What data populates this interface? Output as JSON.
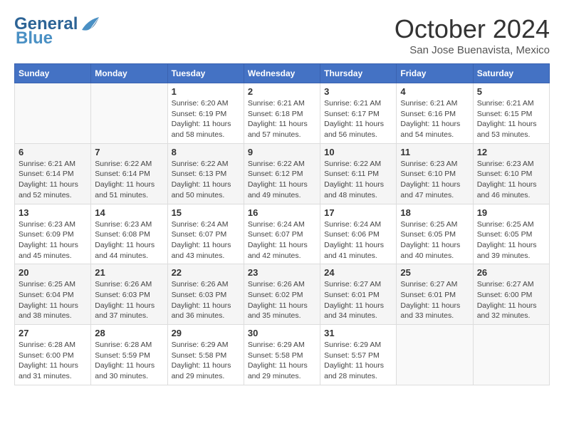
{
  "logo": {
    "line1": "General",
    "line2": "Blue"
  },
  "title": "October 2024",
  "subtitle": "San Jose Buenavista, Mexico",
  "days_of_week": [
    "Sunday",
    "Monday",
    "Tuesday",
    "Wednesday",
    "Thursday",
    "Friday",
    "Saturday"
  ],
  "weeks": [
    [
      {
        "day": "",
        "info": ""
      },
      {
        "day": "",
        "info": ""
      },
      {
        "day": "1",
        "info": "Sunrise: 6:20 AM\nSunset: 6:19 PM\nDaylight: 11 hours and 58 minutes."
      },
      {
        "day": "2",
        "info": "Sunrise: 6:21 AM\nSunset: 6:18 PM\nDaylight: 11 hours and 57 minutes."
      },
      {
        "day": "3",
        "info": "Sunrise: 6:21 AM\nSunset: 6:17 PM\nDaylight: 11 hours and 56 minutes."
      },
      {
        "day": "4",
        "info": "Sunrise: 6:21 AM\nSunset: 6:16 PM\nDaylight: 11 hours and 54 minutes."
      },
      {
        "day": "5",
        "info": "Sunrise: 6:21 AM\nSunset: 6:15 PM\nDaylight: 11 hours and 53 minutes."
      }
    ],
    [
      {
        "day": "6",
        "info": "Sunrise: 6:21 AM\nSunset: 6:14 PM\nDaylight: 11 hours and 52 minutes."
      },
      {
        "day": "7",
        "info": "Sunrise: 6:22 AM\nSunset: 6:14 PM\nDaylight: 11 hours and 51 minutes."
      },
      {
        "day": "8",
        "info": "Sunrise: 6:22 AM\nSunset: 6:13 PM\nDaylight: 11 hours and 50 minutes."
      },
      {
        "day": "9",
        "info": "Sunrise: 6:22 AM\nSunset: 6:12 PM\nDaylight: 11 hours and 49 minutes."
      },
      {
        "day": "10",
        "info": "Sunrise: 6:22 AM\nSunset: 6:11 PM\nDaylight: 11 hours and 48 minutes."
      },
      {
        "day": "11",
        "info": "Sunrise: 6:23 AM\nSunset: 6:10 PM\nDaylight: 11 hours and 47 minutes."
      },
      {
        "day": "12",
        "info": "Sunrise: 6:23 AM\nSunset: 6:10 PM\nDaylight: 11 hours and 46 minutes."
      }
    ],
    [
      {
        "day": "13",
        "info": "Sunrise: 6:23 AM\nSunset: 6:09 PM\nDaylight: 11 hours and 45 minutes."
      },
      {
        "day": "14",
        "info": "Sunrise: 6:23 AM\nSunset: 6:08 PM\nDaylight: 11 hours and 44 minutes."
      },
      {
        "day": "15",
        "info": "Sunrise: 6:24 AM\nSunset: 6:07 PM\nDaylight: 11 hours and 43 minutes."
      },
      {
        "day": "16",
        "info": "Sunrise: 6:24 AM\nSunset: 6:07 PM\nDaylight: 11 hours and 42 minutes."
      },
      {
        "day": "17",
        "info": "Sunrise: 6:24 AM\nSunset: 6:06 PM\nDaylight: 11 hours and 41 minutes."
      },
      {
        "day": "18",
        "info": "Sunrise: 6:25 AM\nSunset: 6:05 PM\nDaylight: 11 hours and 40 minutes."
      },
      {
        "day": "19",
        "info": "Sunrise: 6:25 AM\nSunset: 6:05 PM\nDaylight: 11 hours and 39 minutes."
      }
    ],
    [
      {
        "day": "20",
        "info": "Sunrise: 6:25 AM\nSunset: 6:04 PM\nDaylight: 11 hours and 38 minutes."
      },
      {
        "day": "21",
        "info": "Sunrise: 6:26 AM\nSunset: 6:03 PM\nDaylight: 11 hours and 37 minutes."
      },
      {
        "day": "22",
        "info": "Sunrise: 6:26 AM\nSunset: 6:03 PM\nDaylight: 11 hours and 36 minutes."
      },
      {
        "day": "23",
        "info": "Sunrise: 6:26 AM\nSunset: 6:02 PM\nDaylight: 11 hours and 35 minutes."
      },
      {
        "day": "24",
        "info": "Sunrise: 6:27 AM\nSunset: 6:01 PM\nDaylight: 11 hours and 34 minutes."
      },
      {
        "day": "25",
        "info": "Sunrise: 6:27 AM\nSunset: 6:01 PM\nDaylight: 11 hours and 33 minutes."
      },
      {
        "day": "26",
        "info": "Sunrise: 6:27 AM\nSunset: 6:00 PM\nDaylight: 11 hours and 32 minutes."
      }
    ],
    [
      {
        "day": "27",
        "info": "Sunrise: 6:28 AM\nSunset: 6:00 PM\nDaylight: 11 hours and 31 minutes."
      },
      {
        "day": "28",
        "info": "Sunrise: 6:28 AM\nSunset: 5:59 PM\nDaylight: 11 hours and 30 minutes."
      },
      {
        "day": "29",
        "info": "Sunrise: 6:29 AM\nSunset: 5:58 PM\nDaylight: 11 hours and 29 minutes."
      },
      {
        "day": "30",
        "info": "Sunrise: 6:29 AM\nSunset: 5:58 PM\nDaylight: 11 hours and 29 minutes."
      },
      {
        "day": "31",
        "info": "Sunrise: 6:29 AM\nSunset: 5:57 PM\nDaylight: 11 hours and 28 minutes."
      },
      {
        "day": "",
        "info": ""
      },
      {
        "day": "",
        "info": ""
      }
    ]
  ]
}
